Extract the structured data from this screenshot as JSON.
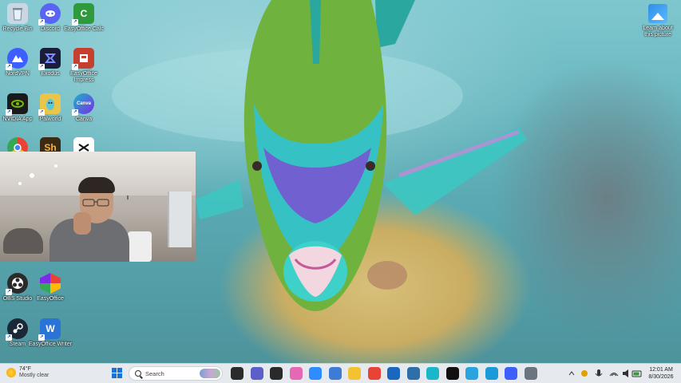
{
  "desktop": {
    "icons": [
      {
        "label": "Recycle Bin",
        "glyph": "",
        "color": "#c9d6e3"
      },
      {
        "label": "Discord",
        "glyph": "",
        "color": "#5865f2"
      },
      {
        "label": "EasyOffice Calc",
        "glyph": "C",
        "color": "#2f9a3c"
      },
      {
        "label": "NordVPN",
        "glyph": "",
        "color": "#3e5fff"
      },
      {
        "label": "Exodus",
        "glyph": "",
        "color": "#1b1b3a"
      },
      {
        "label": "EasyOffice Impress",
        "glyph": "",
        "color": "#c6402f"
      },
      {
        "label": "NVIDIA App",
        "glyph": "",
        "color": "#1a1a1a"
      },
      {
        "label": "Palworld",
        "glyph": "",
        "color": "#e9c64a"
      },
      {
        "label": "Canva",
        "glyph": "Canva",
        "color": "#19b7c9"
      },
      {
        "label": "",
        "glyph": "",
        "color": "#e94335"
      },
      {
        "label": "",
        "glyph": "Sh",
        "color": "#3d2a14"
      },
      {
        "label": "",
        "glyph": "",
        "color": "#ffffff"
      },
      {
        "label": "OBS Studio",
        "glyph": "",
        "color": "#2a2a2a"
      },
      {
        "label": "EasyOffice",
        "glyph": "",
        "color": "#e9a23b"
      },
      {
        "label": "Steam",
        "glyph": "",
        "color": "#1b2838"
      },
      {
        "label": "EasyOffice Writer",
        "glyph": "W",
        "color": "#2b74d6"
      }
    ],
    "learn_about": {
      "label": "Learn about this picture",
      "icon": "picture-icon"
    }
  },
  "taskbar": {
    "weather": {
      "temp": "74°F",
      "condition": "Mostly clear",
      "icon": "sun-icon"
    },
    "search": {
      "placeholder": "Search"
    },
    "apps": [
      {
        "name": "task-view-icon",
        "color": "#2b2b2b"
      },
      {
        "name": "teams-icon",
        "color": "#5b5fc7"
      },
      {
        "name": "app-icon",
        "color": "#2a2a2a"
      },
      {
        "name": "copilot-icon",
        "color": "#e667b3"
      },
      {
        "name": "zoom-icon",
        "color": "#2d8cff"
      },
      {
        "name": "snipping-icon",
        "color": "#3d7bd6"
      },
      {
        "name": "file-explorer-icon",
        "color": "#f2c230"
      },
      {
        "name": "chrome-icon",
        "color": "#e94335"
      },
      {
        "name": "outlook-icon",
        "color": "#1a67c0"
      },
      {
        "name": "app-icon",
        "color": "#2f6fa8"
      },
      {
        "name": "canva-icon",
        "color": "#19b7c9"
      },
      {
        "name": "capcut-icon",
        "color": "#111111"
      },
      {
        "name": "telegram-icon",
        "color": "#2aa3de"
      },
      {
        "name": "edge-icon",
        "color": "#1a9bd8"
      },
      {
        "name": "nordvpn-icon",
        "color": "#3e5fff"
      },
      {
        "name": "settings-icon",
        "color": "#6b7580"
      }
    ],
    "clock": {
      "time": "12:01 AM",
      "date": "8/30/2026"
    }
  }
}
